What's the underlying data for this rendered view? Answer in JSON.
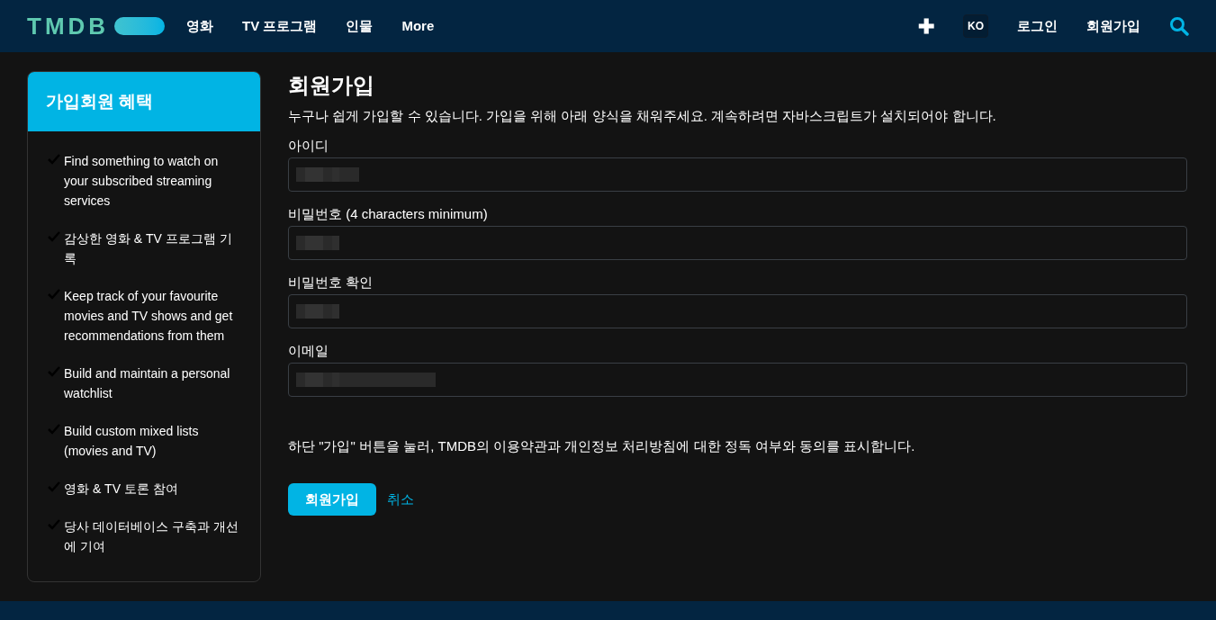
{
  "header": {
    "logo": "TMDB",
    "nav": [
      "영화",
      "TV 프로그램",
      "인물",
      "More"
    ],
    "add_icon": "✚",
    "language": "KO",
    "login": "로그인",
    "signup": "회원가입"
  },
  "sidebar": {
    "title": "가입회원 혜택",
    "items": [
      {
        "text": "Find something to watch on your subscribed streaming services"
      },
      {
        "text": "감상한 영화 & TV 프로그램 기록"
      },
      {
        "text": "Keep track of your favourite movies and TV shows and get recommendations from them"
      },
      {
        "text": "Build and maintain a personal watchlist"
      },
      {
        "text": "Build custom mixed lists (movies and TV)"
      },
      {
        "text": "영화 & TV 토론 참여"
      },
      {
        "text": "당사 데이터베이스 구축과 개선에 기여"
      }
    ]
  },
  "form": {
    "title": "회원가입",
    "intro": "누구나 쉽게 가입할 수 있습니다. 가입을 위해 아래 양식을 채워주세요. 계속하려면 자바스크립트가 설치되어야 합니다.",
    "fields": [
      {
        "label": "아이디",
        "redacted": true
      },
      {
        "label": "비밀번호 (4 characters minimum)",
        "redacted": true
      },
      {
        "label": "비밀번호 확인",
        "redacted": true
      },
      {
        "label": "이메일",
        "redacted": true
      }
    ],
    "notice": "하단 \"가입\" 버튼을 눌러, TMDB의 이용약관과 개인정보 처리방침에 대한 정독 여부와 동의를 표시합니다.",
    "submit": "회원가입",
    "cancel": "취소"
  }
}
